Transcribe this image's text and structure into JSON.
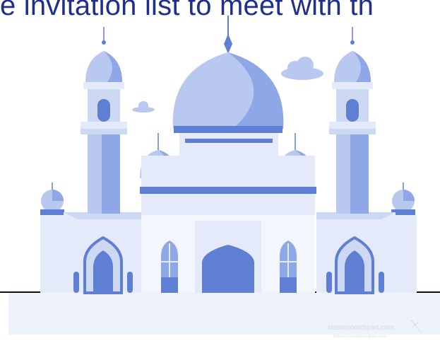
{
  "caption": {
    "text": "e invitation list to meet with th"
  },
  "watermark": {
    "line1": "classroomclipart.com",
    "line2": "https://classroomclipart.com"
  },
  "colors": {
    "caption": "#1f2f8a",
    "dome_light": "#b9c8ef",
    "dome_mid": "#8ea7e6",
    "dome_dark": "#5f7fd3",
    "wall": "#e4eaf9",
    "wall_shadow": "#cdd8f3",
    "ground": "#eef2fb",
    "ground_line": "#111111"
  },
  "illustration": {
    "icon": "mosque-illustration"
  }
}
